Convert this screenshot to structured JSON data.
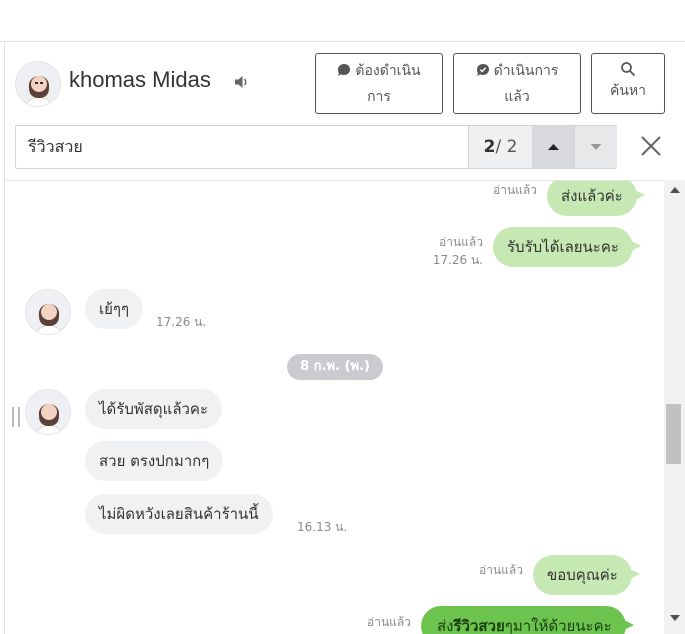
{
  "contact": {
    "name": "khomas Midas"
  },
  "actions": {
    "todo_label_line1": "ต้องดำเนิน",
    "todo_label_line2": "การ",
    "done_label_line1": "ดำเนินการ",
    "done_label_line2": "แล้ว",
    "search_label": "ค้นหา"
  },
  "search": {
    "query": "รีวิวสวย",
    "current": "2",
    "total": "/ 2"
  },
  "date_divider": "8 ก.พ. (พ.)",
  "messages": [
    {
      "direction": "out",
      "text": "ส่งแล้วค่ะ",
      "read": "อ่านแล้ว",
      "time": ""
    },
    {
      "direction": "out",
      "text": "รับรับได้เลยนะคะ",
      "read": "อ่านแล้ว",
      "time": "17.26 น."
    },
    {
      "direction": "in",
      "text": "เย้ๆๆ",
      "time": "17.26 น."
    },
    {
      "direction": "in",
      "text": "ได้รับพัสดุแล้วคะ",
      "time": ""
    },
    {
      "direction": "in",
      "text": "สวย ตรงปกมากๆ",
      "time": ""
    },
    {
      "direction": "in",
      "text": "ไม่ผิดหวังเลยสินค้าร้านนี้",
      "time": "16.13 น."
    },
    {
      "direction": "out",
      "text": "ขอบคุณค่ะ",
      "read": "อ่านแล้ว",
      "time": ""
    },
    {
      "direction": "out",
      "text_before": "ส่ง",
      "text_highlight": "รีวิวสวย",
      "text_after": "ๆมาให้ด้วยนะคะ",
      "read": "อ่านแล้ว",
      "time": ""
    }
  ],
  "icons": {
    "speaker": "speaker-icon",
    "todo": "chat-bubble-icon",
    "done": "check-bubble-icon",
    "search": "search-icon",
    "up": "caret-up-icon",
    "down": "caret-down-icon",
    "close": "close-icon"
  },
  "colors": {
    "outgoing_bubble": "#c6e9b3",
    "incoming_bubble": "#f0f1f3",
    "highlight_bubble": "#6cc44f",
    "date_pill": "#c9cbce"
  }
}
